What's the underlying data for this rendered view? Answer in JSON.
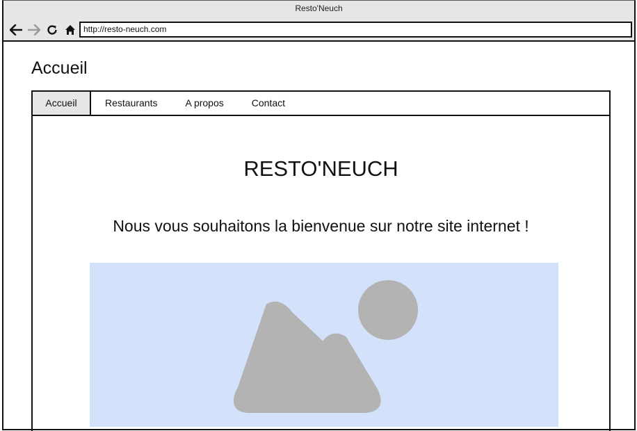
{
  "browser": {
    "title": "Resto'Neuch",
    "url": "http://resto-neuch.com",
    "icons": [
      "back-arrow-icon",
      "forward-arrow-icon",
      "reload-icon",
      "home-icon"
    ]
  },
  "page": {
    "heading": "Accueil"
  },
  "tabs": [
    {
      "label": "Accueil",
      "active": true
    },
    {
      "label": "Restaurants",
      "active": false
    },
    {
      "label": "A propos",
      "active": false
    },
    {
      "label": "Contact",
      "active": false
    }
  ],
  "main": {
    "site_title": "RESTO'NEUCH",
    "welcome": "Nous vous souhaitons la bienvenue sur notre site internet !",
    "image_icon": "image-placeholder-icon"
  },
  "colors": {
    "chrome_bg": "#e6e6e6",
    "placeholder_bg": "#d3e2fa",
    "placeholder_shape": "#b3b3b3",
    "border": "#111111"
  }
}
